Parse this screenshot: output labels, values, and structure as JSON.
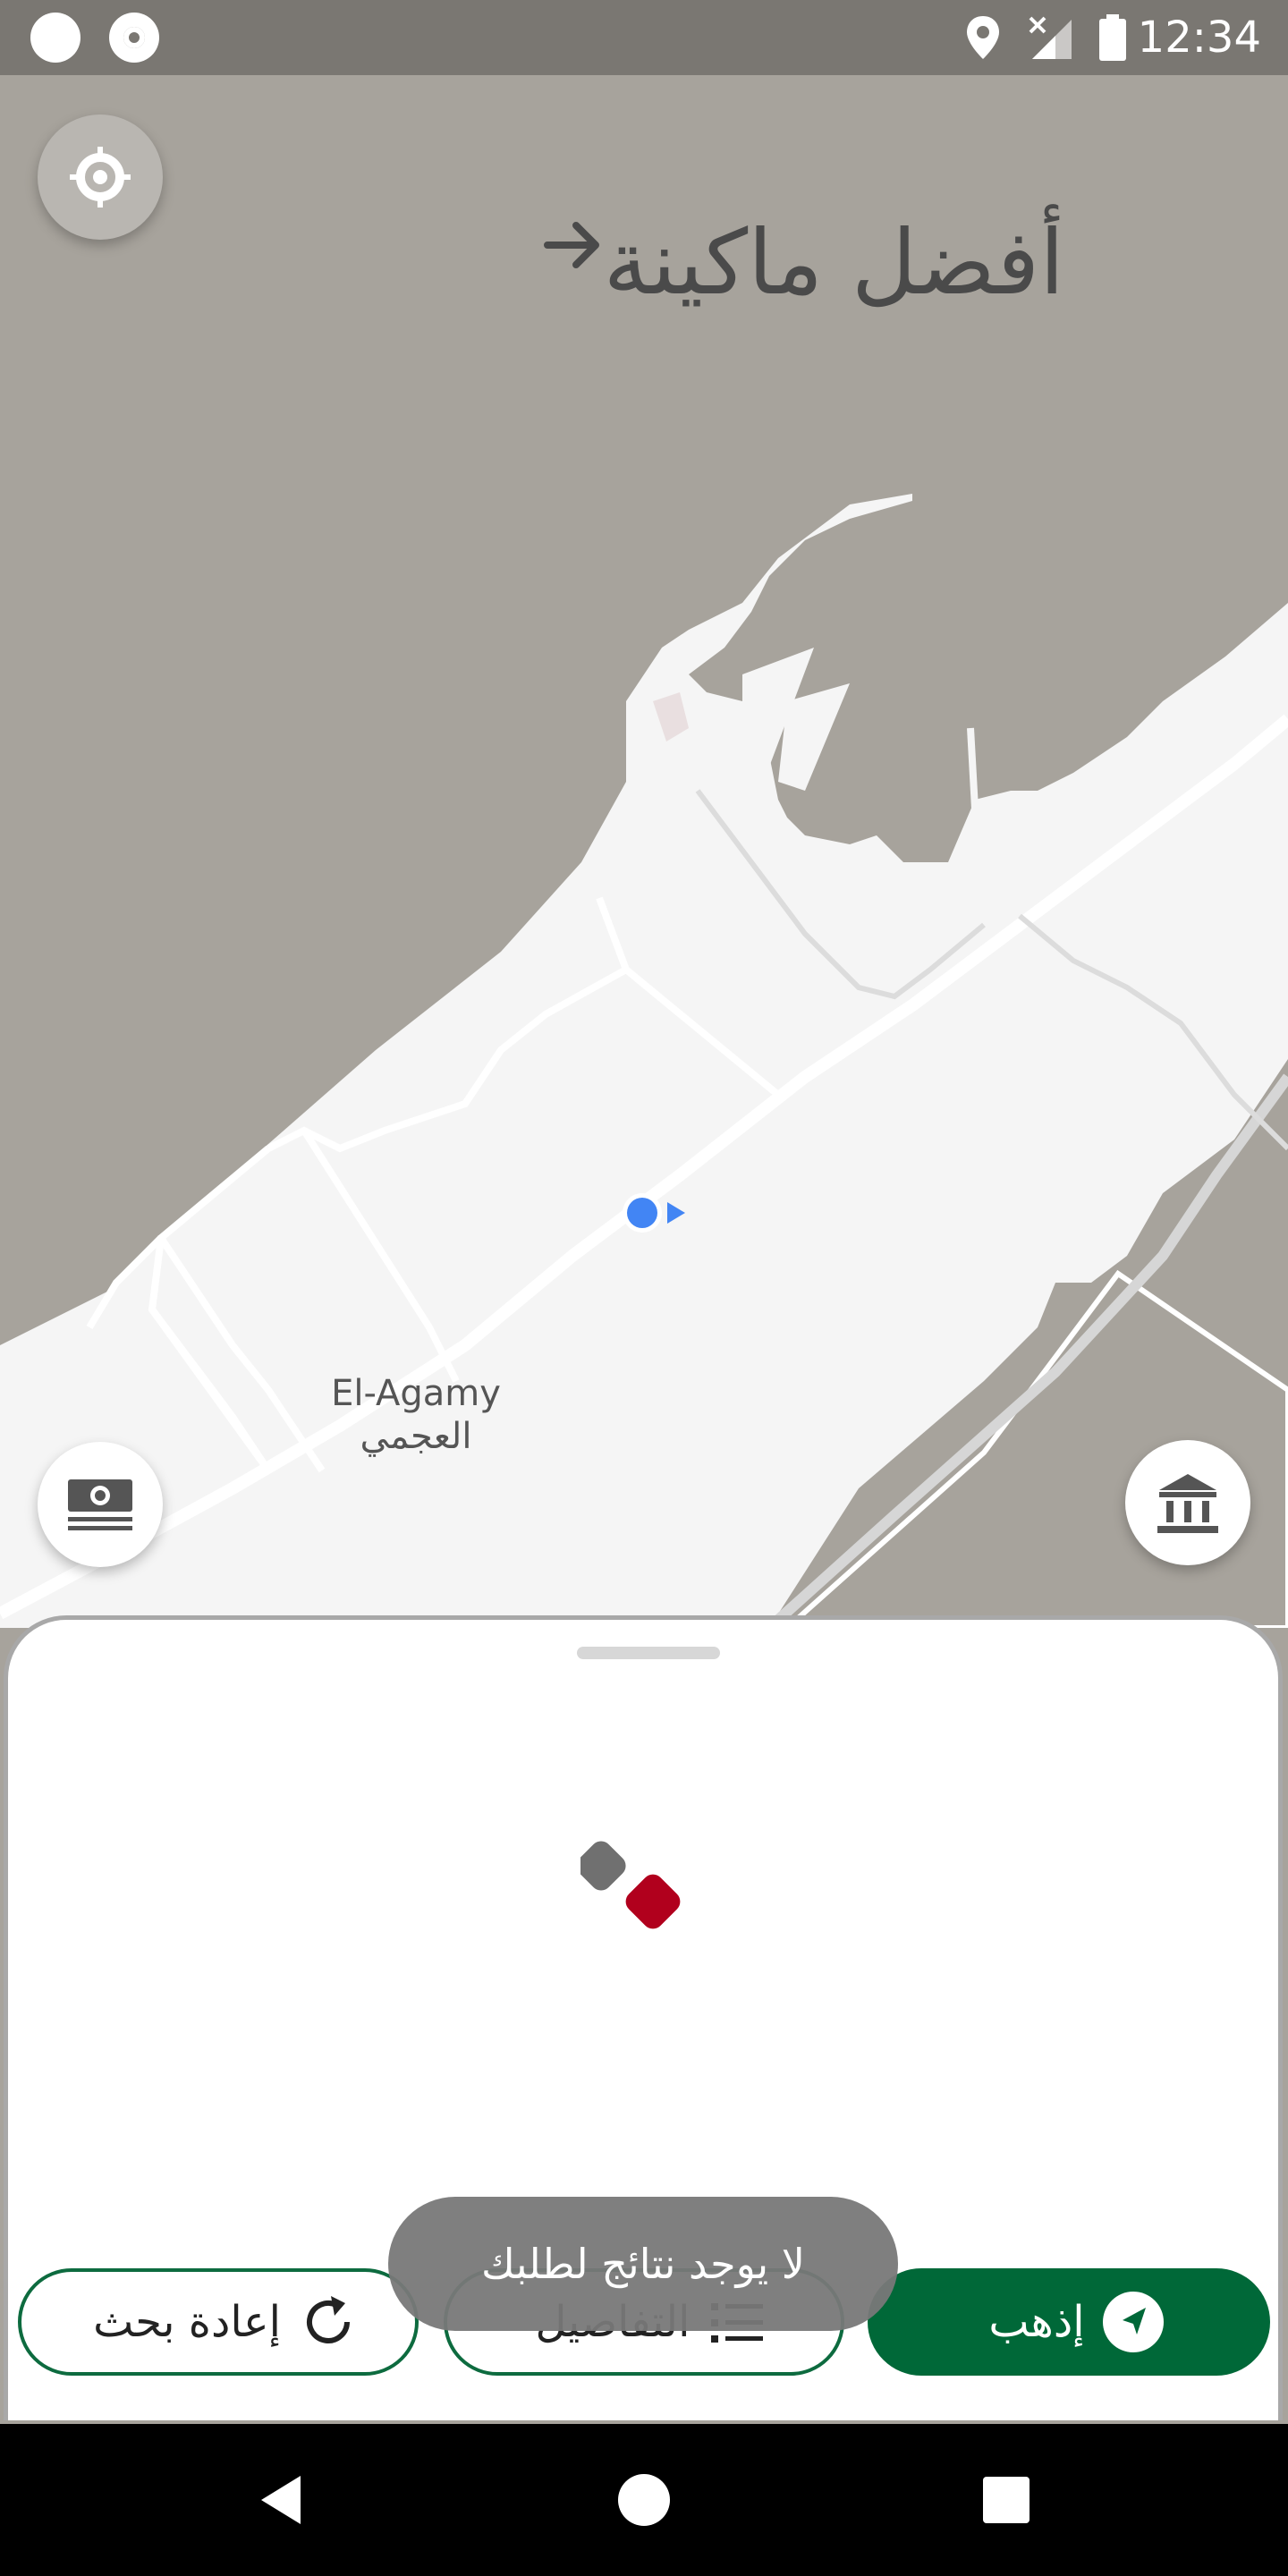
{
  "status_bar": {
    "time": "12:34",
    "icons": [
      "notification-circle-icon",
      "notification-ring-icon",
      "location-icon",
      "signal-icon",
      "battery-icon"
    ]
  },
  "map": {
    "title": "أفضل ماكينة",
    "place_label_en": "El-Agamy",
    "place_label_ar": "العجمي",
    "colors": {
      "water": "#a7a39c",
      "land": "#f5f5f5",
      "road": "#ffffff",
      "my_location": "#4285f4"
    }
  },
  "sheet": {
    "loader_colors": [
      "#707070",
      "#b1001d"
    ],
    "buttons": {
      "go": "إذهب",
      "details": "التفاصيل",
      "research": "إعادة بحث"
    },
    "toast": "لا يوجد نتائج لطلبك"
  },
  "colors": {
    "accent_green": "#006838"
  }
}
